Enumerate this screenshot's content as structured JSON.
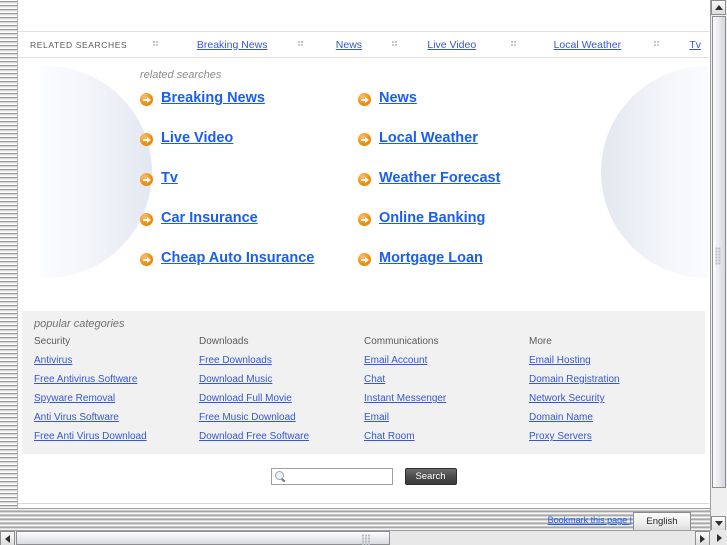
{
  "topbar": {
    "label": "RELATED SEARCHES",
    "separator_icon": "dot-grid-separator",
    "links": [
      "Breaking News",
      "News",
      "Live Video",
      "Local Weather",
      "Tv"
    ]
  },
  "related_searches": {
    "heading": "related searches",
    "arrow_icon": "orange-arrow-icon",
    "rows": [
      {
        "left": "Breaking News",
        "right": "News"
      },
      {
        "left": "Live Video",
        "right": "Local Weather"
      },
      {
        "left": "Tv",
        "right": "Weather Forecast"
      },
      {
        "left": "Car Insurance",
        "right": "Online Banking"
      },
      {
        "left": "Cheap Auto Insurance",
        "right": "Mortgage Loan"
      }
    ]
  },
  "popular_categories": {
    "title": "popular categories",
    "columns": [
      {
        "heading": "Security",
        "links": [
          "Antivirus",
          "Free Antivirus Software",
          "Spyware Removal",
          "Anti Virus Software",
          "Free Anti Virus Download"
        ]
      },
      {
        "heading": "Downloads",
        "links": [
          "Free Downloads",
          "Download Music",
          "Download Full Movie",
          "Free Music Download",
          "Download Free Software"
        ]
      },
      {
        "heading": "Communications",
        "links": [
          "Email Account",
          "Chat",
          "Instant Messenger",
          "Email",
          "Chat Room"
        ]
      },
      {
        "heading": "More",
        "links": [
          "Email Hosting",
          "Domain Registration",
          "Network Security",
          "Domain Name",
          "Proxy Servers"
        ]
      }
    ]
  },
  "search": {
    "icon": "magnifier-icon",
    "value": "",
    "placeholder": "",
    "button_label": "Search"
  },
  "footer": {
    "bookmark_label": "Bookmark this page |",
    "language": "English"
  },
  "colors": {
    "link_blue": "#3457d5",
    "big_link_blue": "#1a5ef0",
    "arrow_orange": "#ef8f10",
    "panel_grey": "#f1f1f1"
  }
}
